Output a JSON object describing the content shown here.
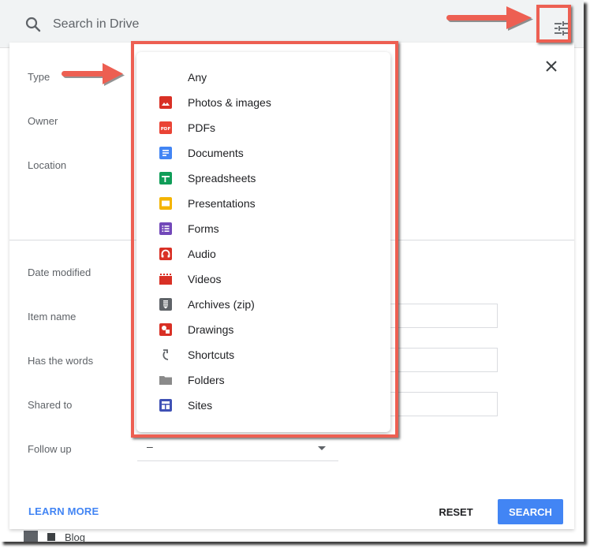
{
  "search": {
    "placeholder": "Search in Drive",
    "search_icon": "search-icon",
    "options_icon": "tune-sliders-icon"
  },
  "dialog": {
    "close_icon": "close-icon",
    "labels": {
      "type": "Type",
      "owner": "Owner",
      "location": "Location",
      "date_modified": "Date modified",
      "item_name": "Item name",
      "has_the_words": "Has the words",
      "shared_to": "Shared to",
      "follow_up": "Follow up"
    },
    "follow_up_value": "–",
    "learn_more": "LEARN MORE",
    "reset": "RESET",
    "search": "SEARCH"
  },
  "type_menu": {
    "items": [
      {
        "label": "Any",
        "icon": "none",
        "color": ""
      },
      {
        "label": "Photos & images",
        "icon": "image-icon",
        "color": "#d93025"
      },
      {
        "label": "PDFs",
        "icon": "pdf-icon",
        "color": "#ea4335"
      },
      {
        "label": "Documents",
        "icon": "document-icon",
        "color": "#4285f4"
      },
      {
        "label": "Spreadsheets",
        "icon": "spreadsheet-icon",
        "color": "#0f9d58"
      },
      {
        "label": "Presentations",
        "icon": "presentation-icon",
        "color": "#f4b400"
      },
      {
        "label": "Forms",
        "icon": "form-icon",
        "color": "#7248b9"
      },
      {
        "label": "Audio",
        "icon": "audio-icon",
        "color": "#d93025"
      },
      {
        "label": "Videos",
        "icon": "video-icon",
        "color": "#d93025"
      },
      {
        "label": "Archives (zip)",
        "icon": "archive-icon",
        "color": "#5f6368"
      },
      {
        "label": "Drawings",
        "icon": "drawing-icon",
        "color": "#d93025"
      },
      {
        "label": "Shortcuts",
        "icon": "shortcut-icon",
        "color": "#5f6368"
      },
      {
        "label": "Folders",
        "icon": "folder-icon",
        "color": "#8a8a8a"
      },
      {
        "label": "Sites",
        "icon": "sites-icon",
        "color": "#3f51b5"
      }
    ]
  },
  "background": {
    "row_label": "Blog"
  },
  "colors": {
    "accent": "#4285f4",
    "annotation": "#ed5f52"
  }
}
